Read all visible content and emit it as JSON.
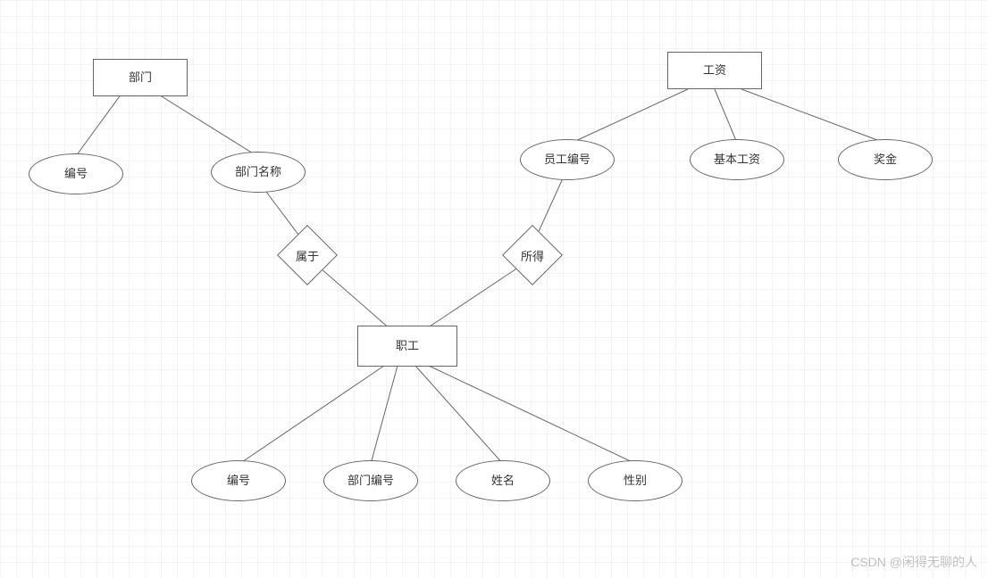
{
  "diagram": {
    "entities": {
      "department": "部门",
      "salary": "工资",
      "employee": "职工"
    },
    "relationships": {
      "belongs_to": "属于",
      "earns": "所得"
    },
    "attributes": {
      "dept_id": "编号",
      "dept_name": "部门名称",
      "salary_emp_id": "员工编号",
      "salary_base": "基本工资",
      "salary_bonus": "奖金",
      "emp_id": "编号",
      "emp_dept_id": "部门编号",
      "emp_name": "姓名",
      "emp_gender": "性别"
    }
  },
  "watermark": "CSDN @闲得无聊的人"
}
